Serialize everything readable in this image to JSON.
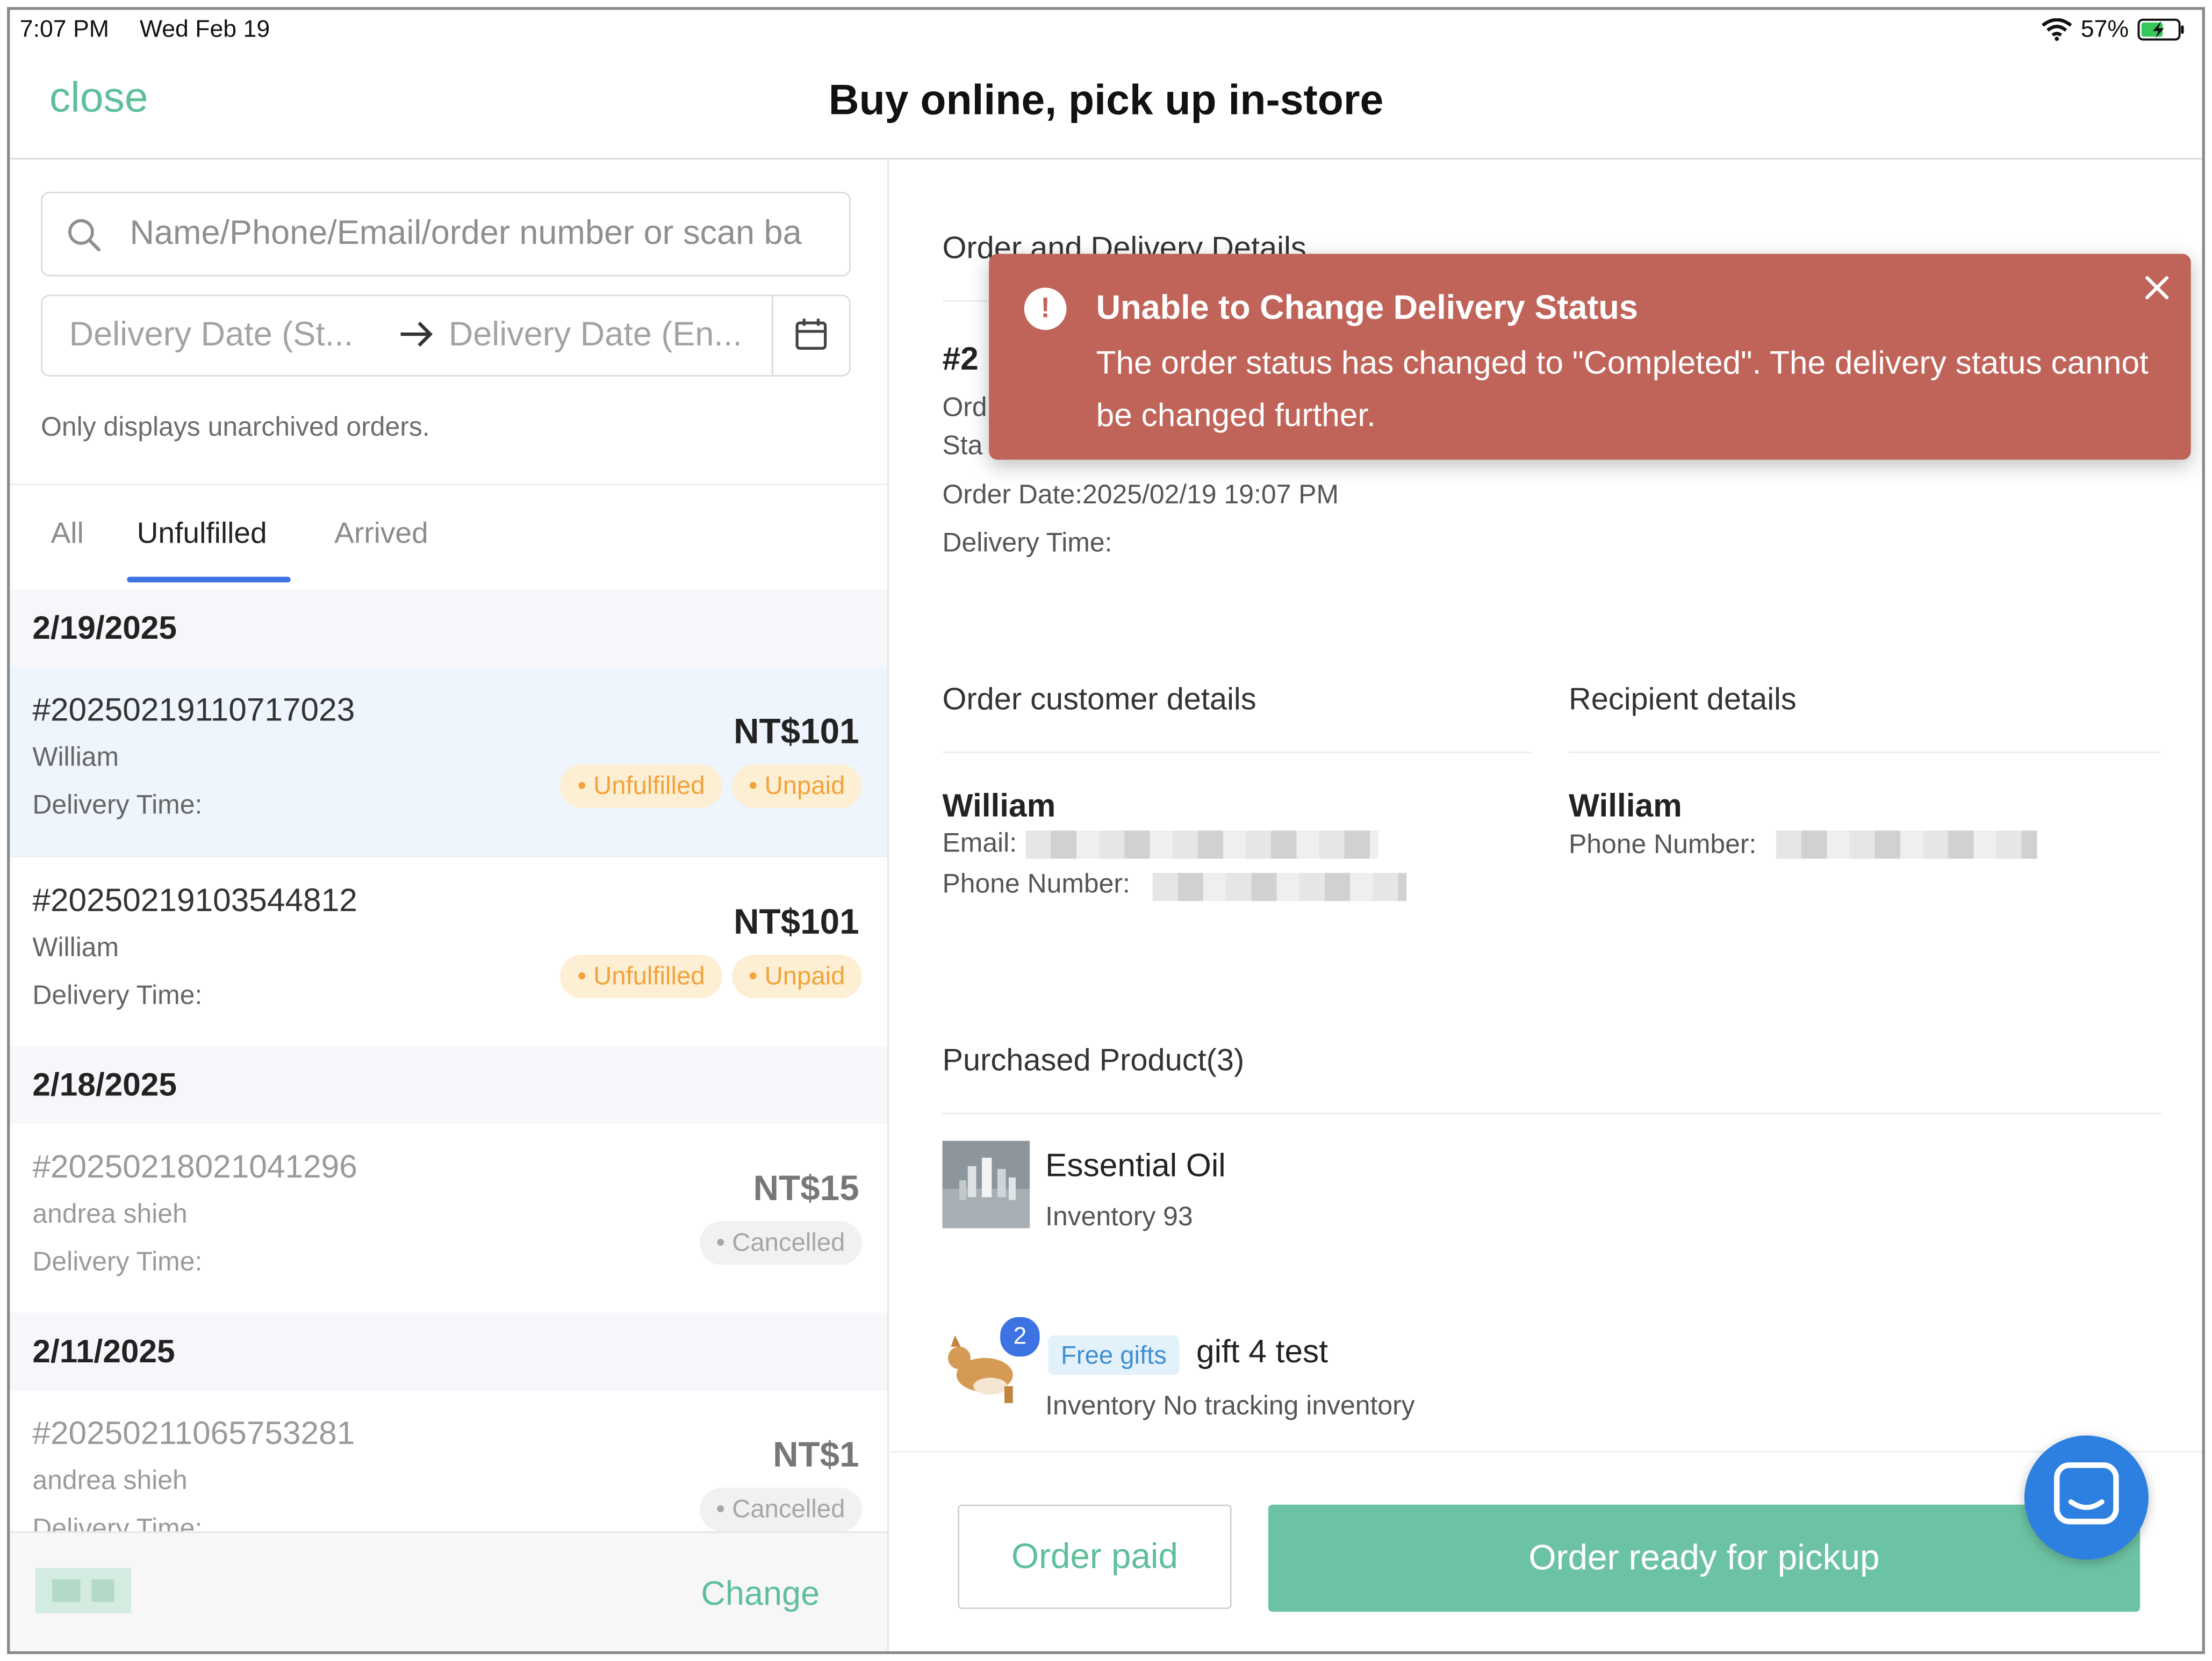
{
  "status_bar": {
    "time": "7:07 PM",
    "date": "Wed Feb 19",
    "battery": "57%"
  },
  "header": {
    "close_label": "close",
    "title": "Buy online, pick up in-store"
  },
  "filters": {
    "search_placeholder": "Name/Phone/Email/order number or scan ba",
    "date_start_placeholder": "Delivery Date (St...",
    "date_end_placeholder": "Delivery Date (En...",
    "note": "Only displays unarchived orders."
  },
  "tabs": {
    "all": "All",
    "unfulfilled": "Unfulfilled",
    "arrived": "Arrived"
  },
  "groups": [
    {
      "date": "2/19/2025",
      "orders": [
        {
          "number": "#20250219110717023",
          "customer": "William",
          "delivery_label": "Delivery Time:",
          "price": "NT$101",
          "badges": [
            "• Unfulfilled",
            "• Unpaid"
          ]
        },
        {
          "number": "#20250219103544812",
          "customer": "William",
          "delivery_label": "Delivery Time:",
          "price": "NT$101",
          "badges": [
            "• Unfulfilled",
            "• Unpaid"
          ]
        }
      ]
    },
    {
      "date": "2/18/2025",
      "orders": [
        {
          "number": "#20250218021041296",
          "customer": "andrea shieh",
          "delivery_label": "Delivery Time:",
          "price": "NT$15",
          "badges": [
            "• Cancelled"
          ]
        }
      ]
    },
    {
      "date": "2/11/2025",
      "orders": [
        {
          "number": "#20250211065753281",
          "customer": "andrea shieh",
          "delivery_label": "Delivery Time:",
          "price": "NT$1",
          "badges": [
            "• Cancelled"
          ]
        }
      ]
    }
  ],
  "left_footer": {
    "change_label": "Change"
  },
  "details": {
    "section_title": "Order and Delivery Details",
    "number_prefix": "#2",
    "ord_fragment": "Ord",
    "sta_fragment": "Sta",
    "order_date": "Order Date:2025/02/19 19:07 PM",
    "delivery_time": "Delivery Time:"
  },
  "customer": {
    "title": "Order customer details",
    "name": "William",
    "email_label": "Email:",
    "phone_label": "Phone Number:"
  },
  "recipient": {
    "title": "Recipient details",
    "name": "William",
    "phone_label": "Phone Number:"
  },
  "products": {
    "title": "Purchased Product(3)",
    "items": [
      {
        "name": "Essential Oil",
        "inventory": "Inventory 93"
      },
      {
        "name": "gift 4 test",
        "tag": "Free gifts",
        "qty": "2",
        "inventory": "Inventory No tracking inventory"
      }
    ]
  },
  "actions": {
    "order_paid": "Order paid",
    "ready_pickup": "Order ready for pickup"
  },
  "toast": {
    "title": "Unable to Change Delivery Status",
    "message": "The order status has changed to \"Completed\". The delivery status cannot be changed further."
  },
  "colors": {
    "accent_green": "#5fbf9a",
    "primary_button": "#6cc3a4",
    "tab_underline": "#3d72e3",
    "toast_bg": "#c0645a",
    "badge_orange": "#f2a23a"
  },
  "icons": [
    "search-icon",
    "arrow-right-icon",
    "calendar-icon",
    "wifi-icon",
    "battery-icon",
    "alert-icon",
    "close-icon",
    "chat-icon"
  ]
}
